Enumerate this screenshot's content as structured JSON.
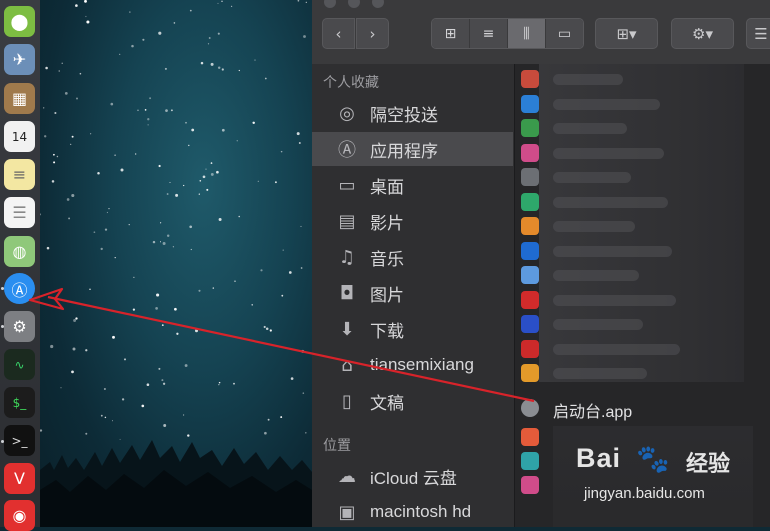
{
  "sidebar": {
    "favorites_header": "个人收藏",
    "locations_header": "位置",
    "items": [
      {
        "icon": "airdrop-icon",
        "glyph": "◎",
        "label": "隔空投送"
      },
      {
        "icon": "applications-icon",
        "glyph": "Ⓐ",
        "label": "应用程序"
      },
      {
        "icon": "desktop-icon",
        "glyph": "▭",
        "label": "桌面"
      },
      {
        "icon": "movies-icon",
        "glyph": "▤",
        "label": "影片"
      },
      {
        "icon": "music-icon",
        "glyph": "♫",
        "label": "音乐"
      },
      {
        "icon": "pictures-icon",
        "glyph": "◘",
        "label": "图片"
      },
      {
        "icon": "downloads-icon",
        "glyph": "⬇",
        "label": "下载"
      },
      {
        "icon": "home-icon",
        "glyph": "⌂",
        "label": "tiansemixiang"
      },
      {
        "icon": "documents-icon",
        "glyph": "▯",
        "label": "文稿"
      }
    ],
    "locations": [
      {
        "icon": "icloud-icon",
        "glyph": "☁",
        "label": "iCloud 云盘"
      },
      {
        "icon": "disk-icon",
        "glyph": "▣",
        "label": "macintosh hd"
      }
    ],
    "selected_index": 1
  },
  "toolbar": {
    "back": "‹",
    "forward": "›",
    "view_icons": [
      "⊞",
      "≡",
      "⫼",
      "▭"
    ],
    "active_view": 2,
    "group_glyph": "⊞▾",
    "action_glyph": "⚙▾",
    "extra_glyph": "☰"
  },
  "files": {
    "visible_item": "启动台.app"
  },
  "watermark": {
    "brand": "Bai",
    "paw": "🐾",
    "brand2": "经验",
    "url": "jingyan.baidu.com"
  },
  "colors": {
    "arrow": "#d8232a",
    "selection": "#4a4a4d",
    "sidebar_bg": "#2f2f31"
  }
}
